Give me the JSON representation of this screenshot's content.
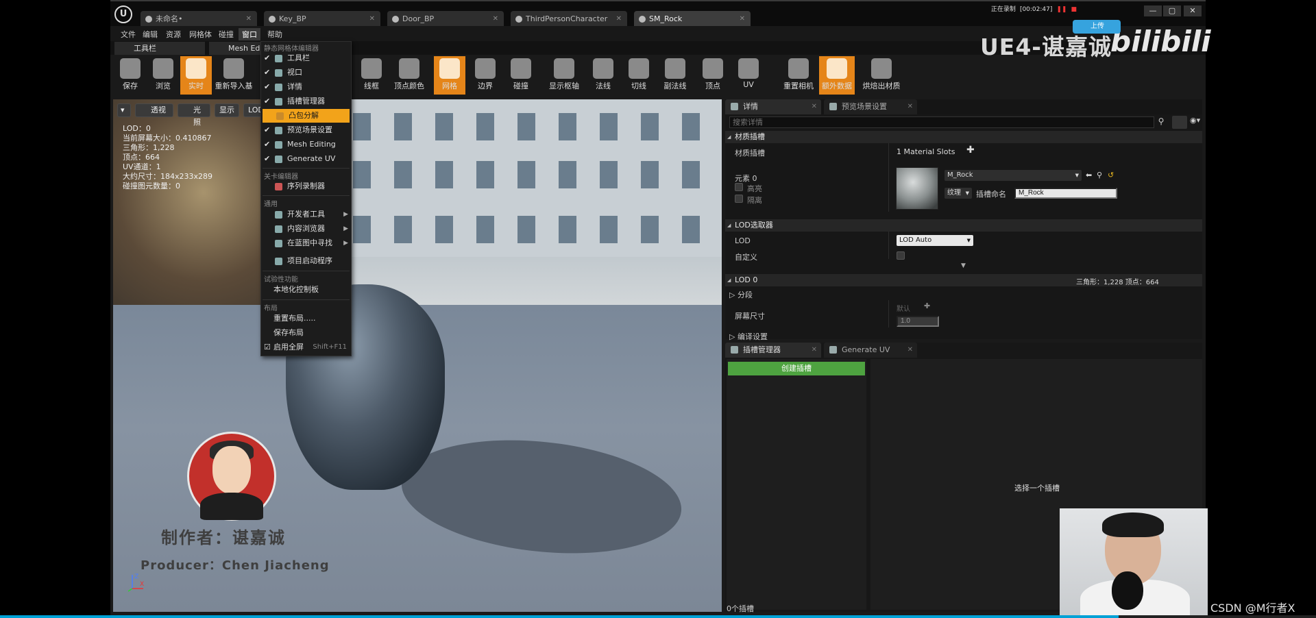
{
  "tabs": [
    {
      "label": "未命名•",
      "active": false
    },
    {
      "label": "Key_BP",
      "active": false
    },
    {
      "label": "Door_BP",
      "active": false
    },
    {
      "label": "ThirdPersonCharacter",
      "active": false
    },
    {
      "label": "SM_Rock",
      "active": true
    }
  ],
  "recording": {
    "label": "正在录制",
    "time": "[00:02:47]"
  },
  "menubar": [
    "文件",
    "编辑",
    "资源",
    "网格体",
    "碰撞",
    "窗口",
    "帮助"
  ],
  "subtabs": [
    "工具栏",
    "Mesh Ed"
  ],
  "toolbar_left": [
    "保存",
    "浏览",
    "实时",
    "重新导入基"
  ],
  "toolbar_right": [
    "线框",
    "顶点颜色",
    "网格",
    "边界",
    "碰撞",
    "显示枢轴",
    "法线",
    "切线",
    "副法线",
    "顶点",
    "UV",
    "重置相机",
    "额外数据",
    "烘焙出材质"
  ],
  "viewport": {
    "buttons": [
      "透视",
      "光照",
      "显示",
      "LOD"
    ],
    "stats": [
      "LOD：0",
      "当前屏幕大小：0.410867",
      "三角形：1,228",
      "顶点：664",
      "UV通道：1",
      "大约尺寸：184x233x289",
      "碰撞图元数量：0"
    ],
    "producer_zh": "制作者：谌嘉诚",
    "producer_en": "Producer：Chen Jiacheng",
    "axis_z": "Z",
    "axis_x": "X"
  },
  "dropdown": {
    "section_mesh": "静态网格体编辑器",
    "items_mesh": [
      {
        "label": "工具栏",
        "checked": true
      },
      {
        "label": "视口",
        "checked": true
      },
      {
        "label": "详情",
        "checked": true
      },
      {
        "label": "插槽管理器",
        "checked": true
      },
      {
        "label": "凸包分解",
        "checked": false,
        "highlight": true
      },
      {
        "label": "预览场景设置",
        "checked": true
      },
      {
        "label": "Mesh Editing",
        "checked": true
      },
      {
        "label": "Generate UV",
        "checked": true
      }
    ],
    "section_level": "关卡编辑器",
    "items_level": [
      "序列录制器"
    ],
    "section_general": "通用",
    "items_general": [
      "开发者工具",
      "内容浏览器",
      "在蓝图中寻找",
      "项目启动程序"
    ],
    "section_experimental": "试验性功能",
    "items_experimental": [
      "本地化控制板"
    ],
    "section_layout": "布局",
    "items_layout": [
      "重置布局.....",
      "保存布局"
    ],
    "fullscreen_label": "启用全屏",
    "fullscreen_shortcut": "Shift+F11"
  },
  "details": {
    "tabs": [
      "详情",
      "预览场景设置"
    ],
    "search_placeholder": "搜索详情",
    "cat_material": "材质插槽",
    "material_slots_label": "材质插槽",
    "material_slots_value": "1 Material Slots",
    "element_label": "元素 0",
    "highlight_label": "高亮",
    "isolate_label": "隔离",
    "material_name": "M_Rock",
    "texture_label": "纹理",
    "slot_name_label": "插槽命名",
    "slot_name_value": "M_Rock",
    "cat_lod_picker": "LOD选取器",
    "lod_label": "LOD",
    "lod_value": "LOD Auto",
    "custom_label": "自定义",
    "cat_lod0": "LOD 0",
    "lod0_stats": "三角形：1,228   顶点：664",
    "sections_label": "分段",
    "screen_size_label": "屏幕尺寸",
    "default_label": "默认",
    "screen_size_value": "1.0",
    "build_settings_label": "编译设置"
  },
  "socket_panel": {
    "tabs": [
      "插槽管理器",
      "Generate UV"
    ],
    "create_button": "创建插槽",
    "empty_text": "选择一个插槽",
    "count": "0个插槽"
  },
  "watermark": {
    "title": "UE4-谌嘉诚",
    "bili": "bilibili",
    "upload": "上传"
  },
  "csdn": "CSDN @M行者X",
  "video_progress": 0.85,
  "colors": {
    "accent": "#e58519",
    "highlight": "#f2a31a",
    "create": "#4ea340",
    "bili_blue": "#00a1d6"
  }
}
